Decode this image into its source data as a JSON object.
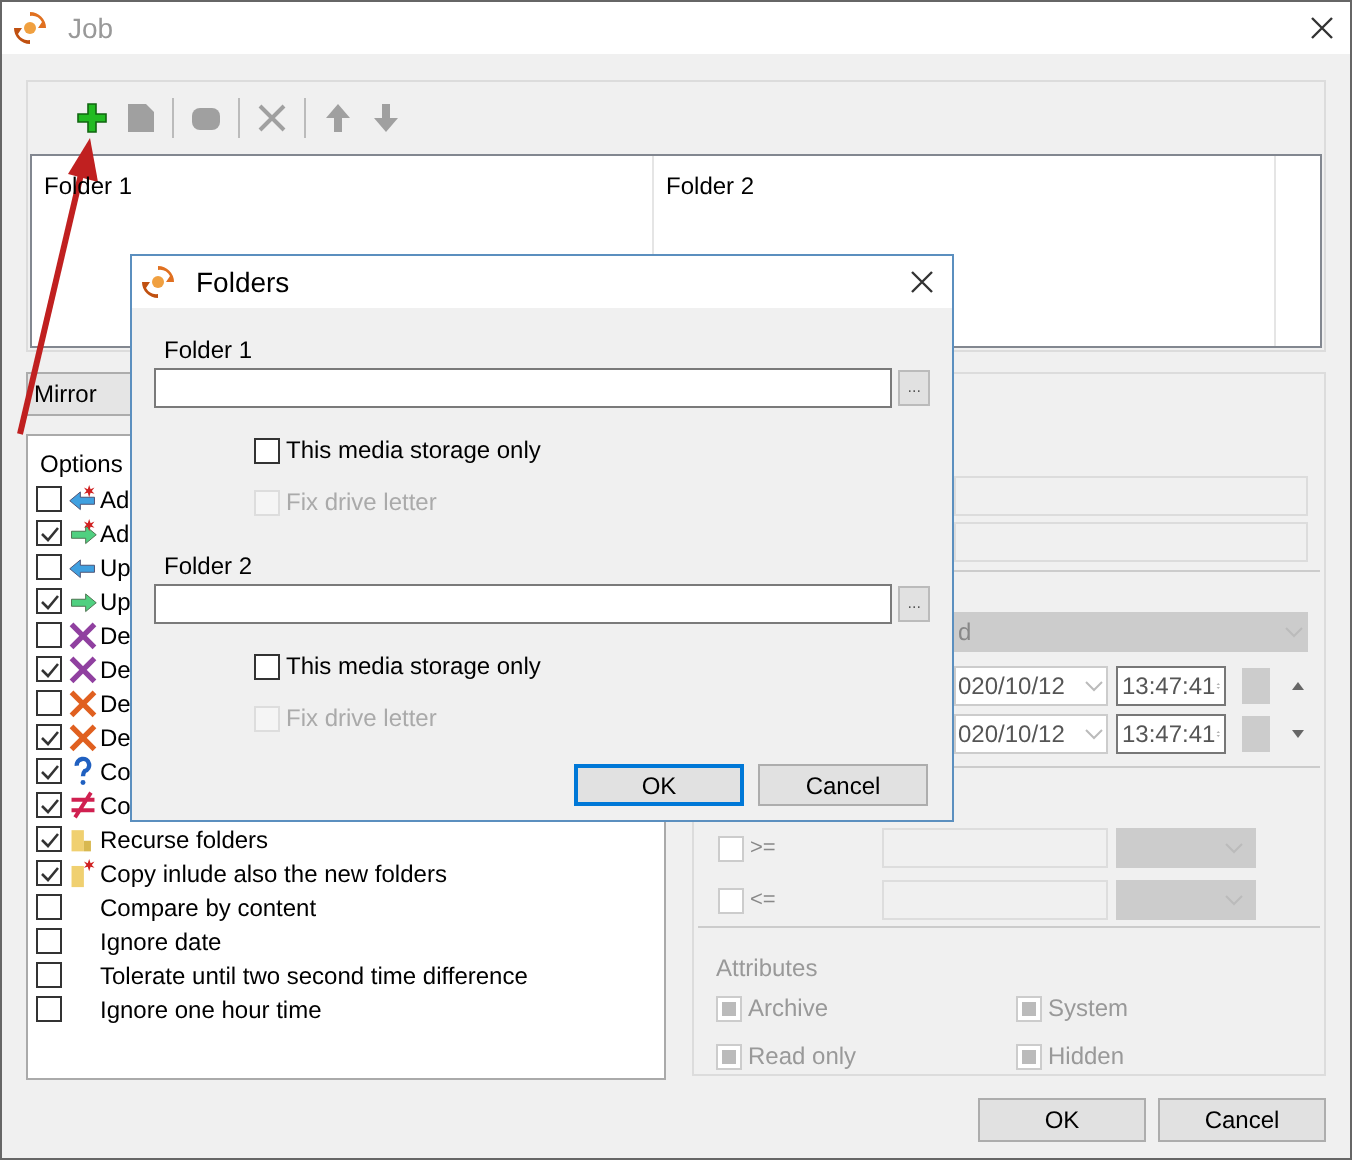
{
  "window": {
    "title": "Job"
  },
  "toolbar": [
    {
      "kind": "add",
      "disabled": false
    },
    {
      "kind": "edit",
      "disabled": true
    },
    {
      "kind": "separator"
    },
    {
      "kind": "copy",
      "disabled": true
    },
    {
      "kind": "separator"
    },
    {
      "kind": "delete",
      "disabled": true
    },
    {
      "kind": "separator"
    },
    {
      "kind": "up",
      "disabled": true
    },
    {
      "kind": "down",
      "disabled": true
    }
  ],
  "folder_list": {
    "columns": [
      "Folder 1",
      "Folder 2"
    ]
  },
  "mode_dropdown": {
    "value": "Mirror"
  },
  "options": {
    "title": "Options",
    "items": [
      {
        "label": "Ad",
        "checked": false,
        "kind": "add_left"
      },
      {
        "label": "Ad",
        "checked": true,
        "kind": "add_right"
      },
      {
        "label": "Up",
        "checked": false,
        "kind": "update_left"
      },
      {
        "label": "Up",
        "checked": true,
        "kind": "update_right"
      },
      {
        "label": "De",
        "checked": false,
        "kind": "delete_purple"
      },
      {
        "label": "De",
        "checked": true,
        "kind": "delete_purple"
      },
      {
        "label": "De",
        "checked": false,
        "kind": "delete_orange"
      },
      {
        "label": "De",
        "checked": true,
        "kind": "delete_orange"
      },
      {
        "label": "Co",
        "checked": true,
        "kind": "question"
      },
      {
        "label": "Co",
        "checked": true,
        "kind": "not_equal"
      },
      {
        "label": "Recurse folders",
        "checked": true,
        "kind": "folder"
      },
      {
        "label": "Copy inlude also the new folders",
        "checked": true,
        "kind": "folder_new"
      },
      {
        "label": "Compare by content",
        "checked": false,
        "kind": "none"
      },
      {
        "label": "Ignore date",
        "checked": false,
        "kind": "none"
      },
      {
        "label": "Tolerate until two second time difference",
        "checked": false,
        "kind": "none"
      },
      {
        "label": "Ignore one hour time",
        "checked": false,
        "kind": "none"
      }
    ]
  },
  "filter_combo": {
    "value": "d",
    "disabled": true
  },
  "date_rows": [
    {
      "date": "020/10/12",
      "time": "13:47:41"
    },
    {
      "date": "020/10/12",
      "time": "13:47:41"
    }
  ],
  "size_rows": [
    {
      "operator": ">=",
      "checked": false
    },
    {
      "operator": "<=",
      "checked": false
    }
  ],
  "attributes": {
    "title": "Attributes",
    "items": [
      {
        "label": "Archive",
        "indeterminate": true
      },
      {
        "label": "System",
        "indeterminate": true
      },
      {
        "label": "Read only",
        "indeterminate": true
      },
      {
        "label": "Hidden",
        "indeterminate": true
      }
    ]
  },
  "buttons": [
    "OK",
    "Cancel"
  ],
  "dialog": {
    "title": "Folders",
    "folders": [
      {
        "label": "Folder 1",
        "media_label": "This media storage only",
        "media_only": false,
        "fix_label": "Fix drive letter",
        "fix_drive": false,
        "fix_disabled": true
      },
      {
        "label": "Folder 2",
        "media_label": "This media storage only",
        "media_only": false,
        "fix_label": "Fix drive letter",
        "fix_drive": false,
        "fix_disabled": true
      }
    ],
    "browse_label": "...",
    "buttons": [
      {
        "label": "OK",
        "default": true
      },
      {
        "label": "Cancel",
        "default": false
      }
    ]
  }
}
